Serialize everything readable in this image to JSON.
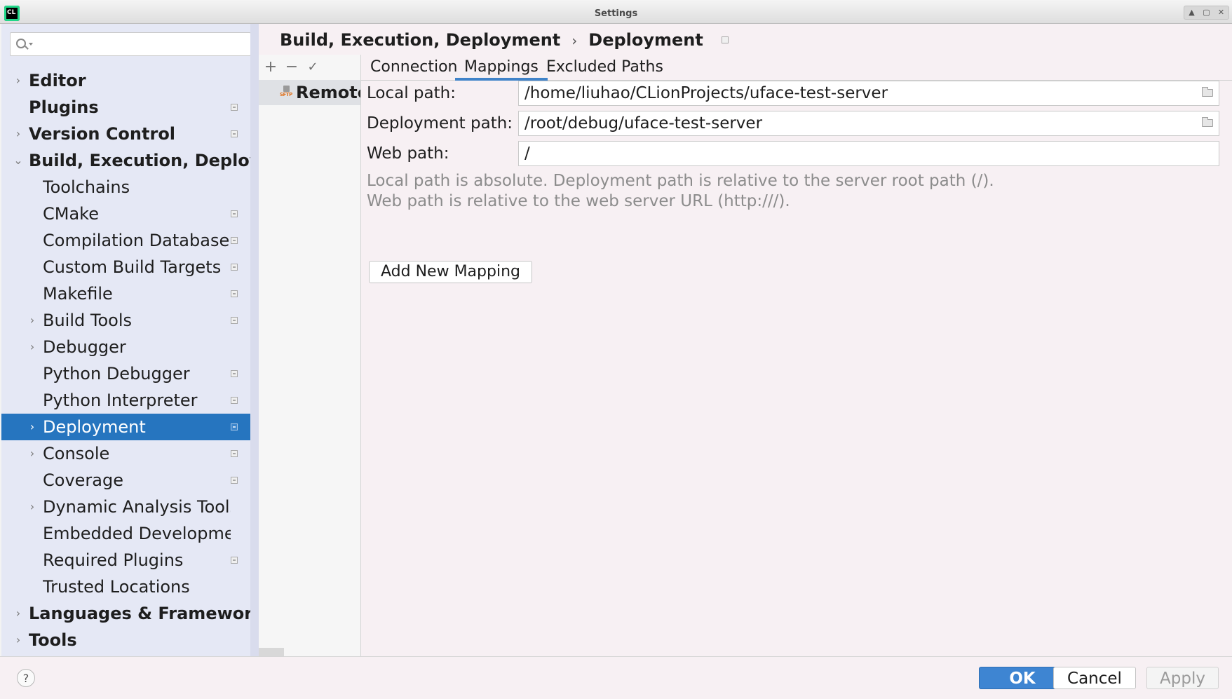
{
  "window": {
    "title": "Settings",
    "logo_text": "CL",
    "controls": [
      "▲",
      "▢",
      "✕"
    ]
  },
  "search": {
    "placeholder": "",
    "value": ""
  },
  "sidebar": {
    "items": [
      {
        "label": "Editor",
        "level": 0,
        "expander": "›",
        "project_icon": false
      },
      {
        "label": "Plugins",
        "level": 0,
        "expander": "",
        "project_icon": true
      },
      {
        "label": "Version Control",
        "level": 0,
        "expander": "›",
        "project_icon": true
      },
      {
        "label": "Build, Execution, Deployment",
        "level": 0,
        "expander": "⌄",
        "project_icon": false
      },
      {
        "label": "Toolchains",
        "level": 1,
        "expander": "",
        "project_icon": false
      },
      {
        "label": "CMake",
        "level": 1,
        "expander": "",
        "project_icon": true
      },
      {
        "label": "Compilation Database",
        "level": 1,
        "expander": "",
        "project_icon": true
      },
      {
        "label": "Custom Build Targets",
        "level": 1,
        "expander": "",
        "project_icon": true
      },
      {
        "label": "Makefile",
        "level": 1,
        "expander": "",
        "project_icon": true
      },
      {
        "label": "Build Tools",
        "level": 1,
        "expander": "›",
        "project_icon": true
      },
      {
        "label": "Debugger",
        "level": 1,
        "expander": "›",
        "project_icon": false
      },
      {
        "label": "Python Debugger",
        "level": 1,
        "expander": "",
        "project_icon": true
      },
      {
        "label": "Python Interpreter",
        "level": 1,
        "expander": "",
        "project_icon": true
      },
      {
        "label": "Deployment",
        "level": 1,
        "expander": "›",
        "project_icon": true,
        "selected": true
      },
      {
        "label": "Console",
        "level": 1,
        "expander": "›",
        "project_icon": true
      },
      {
        "label": "Coverage",
        "level": 1,
        "expander": "",
        "project_icon": true
      },
      {
        "label": "Dynamic Analysis Tools",
        "level": 1,
        "expander": "›",
        "project_icon": false
      },
      {
        "label": "Embedded Development",
        "level": 1,
        "expander": "",
        "project_icon": false
      },
      {
        "label": "Required Plugins",
        "level": 1,
        "expander": "",
        "project_icon": true
      },
      {
        "label": "Trusted Locations",
        "level": 1,
        "expander": "",
        "project_icon": false
      },
      {
        "label": "Languages & Frameworks",
        "level": 0,
        "expander": "›",
        "project_icon": false
      },
      {
        "label": "Tools",
        "level": 0,
        "expander": "›",
        "project_icon": false
      }
    ]
  },
  "breadcrumb": {
    "parent": "Build, Execution, Deployment",
    "separator": "›",
    "current": "Deployment"
  },
  "servers": {
    "toolbar": {
      "add": "+",
      "remove": "−",
      "default": "✓"
    },
    "items": [
      {
        "name": "Remote",
        "icon_text": "SFTP"
      }
    ]
  },
  "tabs": [
    {
      "label": "Connection",
      "active": false
    },
    {
      "label": "Mappings",
      "active": true
    },
    {
      "label": "Excluded Paths",
      "active": false
    }
  ],
  "mappings": {
    "local_path": {
      "label": "Local path:",
      "value": "/home/liuhao/CLionProjects/uface-test-server"
    },
    "deployment_path": {
      "label": "Deployment path:",
      "value": "/root/debug/uface-test-server"
    },
    "web_path": {
      "label": "Web path:",
      "value": "/"
    },
    "hint_line1": "Local path is absolute. Deployment path is relative to the server root path (/).",
    "hint_line2": "Web path is relative to the web server URL (http:///).",
    "add_button": "Add New Mapping"
  },
  "footer": {
    "help": "?",
    "ok": "OK",
    "cancel": "Cancel",
    "apply": "Apply"
  },
  "colors": {
    "selection": "#2675bf",
    "sidebar_bg": "#e5e8f5",
    "ok_button": "#3e85d2",
    "tab_underline": "#4083c9"
  },
  "icons": {
    "search": "search-icon",
    "folder": "folder-icon",
    "project": "project-scope-icon",
    "server": "sftp-server-icon"
  }
}
